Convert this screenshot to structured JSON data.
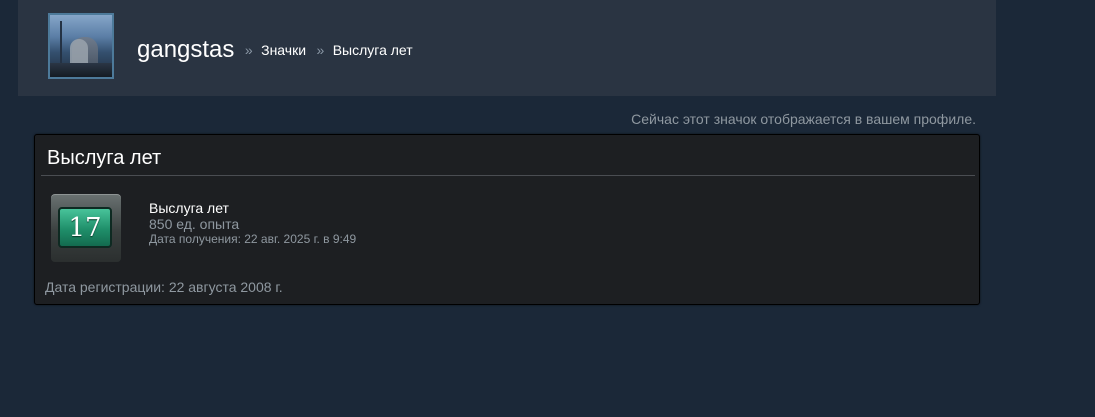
{
  "header": {
    "avatar_icon": "user-avatar",
    "username": "gangstas",
    "breadcrumb_sep": "»",
    "breadcrumbs": [
      {
        "label": "Значки"
      },
      {
        "label": "Выслуга лет"
      }
    ]
  },
  "note": "Сейчас этот значок отображается в вашем профиле.",
  "card": {
    "title": "Выслуга лет",
    "badge": {
      "icon": "years-of-service-badge-icon",
      "number": "17",
      "name": "Выслуга лет",
      "xp": "850 ед. опыта",
      "unlocked": "Дата получения: 22 авг. 2025 г. в 9:49"
    },
    "registration": "Дата регистрации: 22 августа 2008 г."
  },
  "colors": {
    "page_bg": "#1b2838",
    "header_bg": "#2a3442",
    "card_bg": "#1d1f22",
    "muted_text": "#8f98a0",
    "badge_green": "#1f8f6a"
  }
}
